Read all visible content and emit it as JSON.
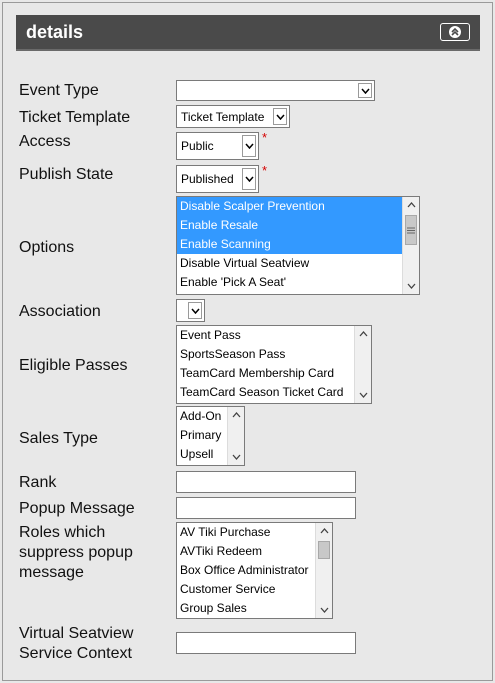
{
  "header": {
    "title": "details",
    "collapse_icon": "collapse-up-icon"
  },
  "fields": {
    "event_type": {
      "label": "Event Type",
      "value": ""
    },
    "ticket_template": {
      "label": "Ticket Template",
      "value": "Ticket Template"
    },
    "access": {
      "label": "Access",
      "value": "Public",
      "required": "*"
    },
    "publish_state": {
      "label": "Publish State",
      "value": "Published",
      "required": "*"
    },
    "options": {
      "label": "Options",
      "items": [
        "Disable Scalper Prevention",
        "Enable Resale",
        "Enable Scanning",
        "Disable Virtual Seatview",
        "Enable 'Pick A Seat'"
      ]
    },
    "association": {
      "label": "Association",
      "value": ""
    },
    "eligible_passes": {
      "label": "Eligible Passes",
      "items": [
        "Event Pass",
        "SportsSeason Pass",
        "TeamCard Membership Card",
        "TeamCard Season Ticket Card"
      ]
    },
    "sales_type": {
      "label": "Sales Type",
      "items": [
        "Add-On",
        "Primary",
        "Upsell"
      ]
    },
    "rank": {
      "label": "Rank",
      "value": ""
    },
    "popup_message": {
      "label": "Popup Message",
      "value": ""
    },
    "roles": {
      "label_line1": "Roles which",
      "label_line2": "suppress popup",
      "label_line3": "message",
      "items": [
        "AV Tiki Purchase",
        "AVTiki Redeem",
        "Box Office Administrator",
        "Customer Service",
        "Group Sales"
      ]
    },
    "virtual_seatview": {
      "label_line1": "Virtual Seatview",
      "label_line2": "Service Context",
      "value": ""
    }
  },
  "colors": {
    "header_bg": "#4a4a4a",
    "selection": "#3399ff",
    "required": "#d40000",
    "panel_bg": "#e8e8e8"
  }
}
